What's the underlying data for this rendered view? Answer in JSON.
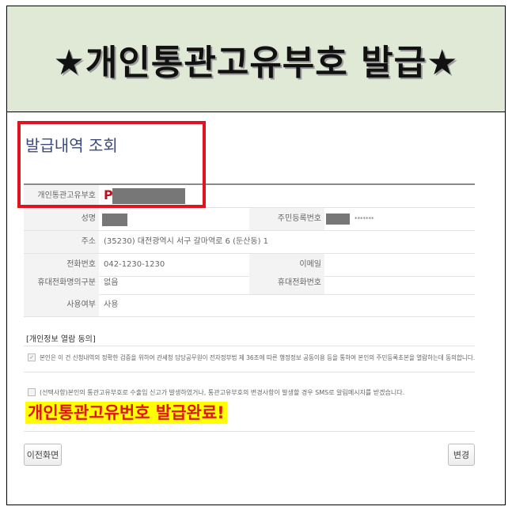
{
  "banner": {
    "title": "★개인통관고유부호 발급★"
  },
  "section": {
    "title": "발급내역 조회"
  },
  "info": {
    "customs_code_label": "개인통관고유부호",
    "customs_code_prefix": "P",
    "name_label": "성명",
    "rrn_label": "주민등록번호",
    "rrn_suffix": "*******",
    "address_label": "주소",
    "address_value": "(35230) 대전광역시 서구 갈마역로 6 (둔산동) 1",
    "phone_label": "전화번호",
    "phone_value": "042-1230-1230",
    "email_label": "이메일",
    "email_value": "",
    "mobile_type_label": "휴대전화명의구분",
    "mobile_type_value": "없음",
    "mobile_label": "휴대전화번호",
    "mobile_value": "",
    "use_label": "사용여부",
    "use_value": "사용"
  },
  "consent": {
    "heading": "[개인정보 열람 동의]",
    "item1": "본인은 이 건 신청내역의 정확한 검증을 위하여 관세청 담당공무원이 전자정부법 제 36조에 따른 행정정보 공동이용 등을 통하여 본인의 주민등록초본을 열람하는데 동의합니다.",
    "item2": "(선택사항)본인의 통관고유부호로 수출입 신고가 발생하였거나, 통관고유부호의 변경사항이 발생할 경우 SMS로 알림메시지를 받겠습니다."
  },
  "annotation": "개인통관고유번호 발급완료!",
  "buttons": {
    "back": "이전화면",
    "change": "변경"
  }
}
